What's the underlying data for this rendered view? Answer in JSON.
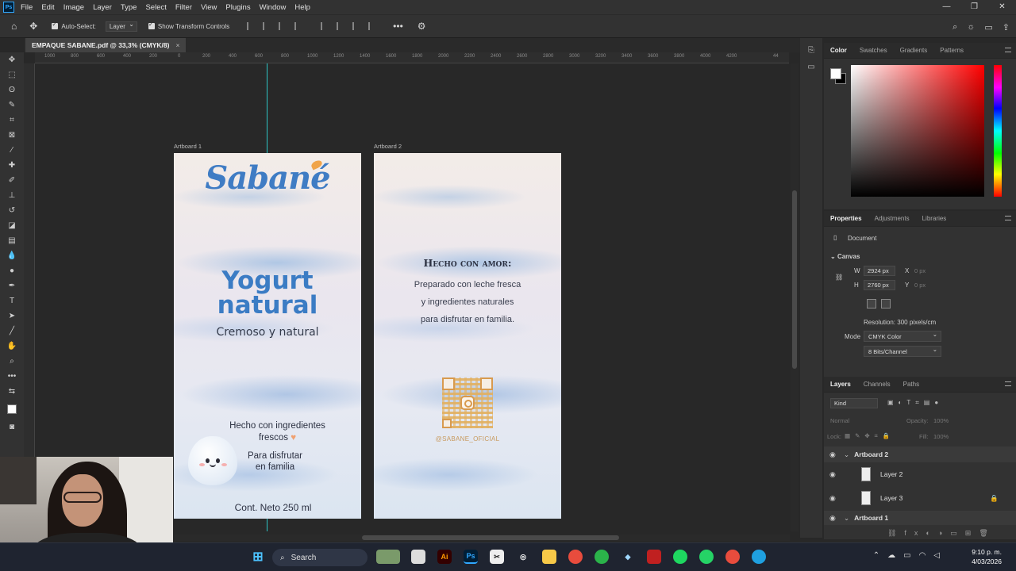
{
  "menubar": {
    "logo": "Ps",
    "items": [
      "File",
      "Edit",
      "Image",
      "Layer",
      "Type",
      "Select",
      "Filter",
      "View",
      "Plugins",
      "Window",
      "Help"
    ]
  },
  "options": {
    "auto_select_label": "Auto-Select:",
    "layer_select": "Layer",
    "show_transform_label": "Show Transform Controls"
  },
  "document": {
    "tab_title": "EMPAQUE SABANE.pdf @ 33,3% (CMYK/8)",
    "tab_close": "×"
  },
  "ruler": {
    "ticks": [
      "1000",
      "800",
      "600",
      "400",
      "200",
      "0",
      "200",
      "400",
      "600",
      "800",
      "1000",
      "1200",
      "1400",
      "1600",
      "1800",
      "2000",
      "2200",
      "2400",
      "2600",
      "2800",
      "3000",
      "3200",
      "3400",
      "3600",
      "3800",
      "4000",
      "4200",
      "44"
    ]
  },
  "artboard1": {
    "label": "Artboard 1",
    "brand": "Sabané",
    "title_line1": "Yogurt",
    "title_line2": "natural",
    "subtitle": "Cremoso y natural",
    "made_line1": "Hecho con ingredientes",
    "made_line2": "frescos",
    "heart": "♥",
    "family_line1": "Para disfrutar",
    "family_line2": "en familia",
    "net": "Cont. Neto 250 ml"
  },
  "artboard2": {
    "label": "Artboard 2",
    "heading": "Hecho con amor:",
    "body_line1": "Preparado con leche fresca",
    "body_line2": "y ingredientes naturales",
    "body_line3": "para disfrutar en familia.",
    "handle": "@SABANE_OFICIAL"
  },
  "color_panel": {
    "tabs": [
      "Color",
      "Swatches",
      "Gradients",
      "Patterns"
    ],
    "active_tab": "Color",
    "foreground": "#ffffff",
    "background": "#000000",
    "hue": "#ff0000"
  },
  "properties_panel": {
    "tabs": [
      "Properties",
      "Adjustments",
      "Libraries"
    ],
    "doc_label": "Document",
    "section": "Canvas",
    "w_label": "W",
    "w_value": "2924 px",
    "x_label": "X",
    "x_placeholder": "0 px",
    "h_label": "H",
    "h_value": "2760 px",
    "y_label": "Y",
    "y_placeholder": "0 px",
    "resolution": "Resolution: 300 pixels/cm",
    "mode_label": "Mode",
    "mode_value": "CMYK Color",
    "bits_value": "8 Bits/Channel"
  },
  "layers_panel": {
    "tabs": [
      "Layers",
      "Channels",
      "Paths"
    ],
    "kind_label": "Kind",
    "blend_mode": "Normal",
    "opacity_label": "Opacity:",
    "opacity_value": "100%",
    "lock_label": "Lock:",
    "fill_label": "Fill:",
    "fill_value": "100%",
    "rows": [
      {
        "name": "Artboard 2",
        "type": "artboard"
      },
      {
        "name": "Layer 2",
        "type": "layer"
      },
      {
        "name": "Layer 3",
        "type": "layer",
        "locked": true
      },
      {
        "name": "Artboard 1",
        "type": "artboard"
      }
    ]
  },
  "taskbar": {
    "search_label": "Search",
    "time": "9:10 p. m.",
    "date": "4/03/2026",
    "ai_label": "Ai",
    "ps_label": "Ps"
  },
  "window_controls": {
    "minimize": "—",
    "restore": "❐",
    "close": "✕"
  }
}
